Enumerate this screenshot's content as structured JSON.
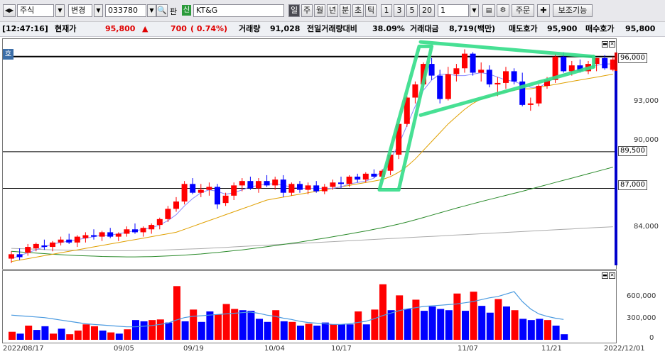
{
  "toolbar": {
    "market": "주식",
    "change_label": "변경",
    "code": "033780",
    "pan_label": "판",
    "sin_badge": "신",
    "stock_name": "KT&G",
    "periods": [
      "일",
      "주",
      "월",
      "년",
      "분",
      "초",
      "틱"
    ],
    "selected_period": "일",
    "intervals": [
      "1",
      "3",
      "5",
      "20"
    ],
    "interval_value": "1",
    "order_button": "주문",
    "aux_button": "보조기능"
  },
  "info": {
    "time": "[12:47:16]",
    "price_label": "현재가",
    "price": "95,800",
    "arrow": "▲",
    "change": "700",
    "change_pct": "( 0.74%)",
    "volume_label": "거래량",
    "volume": "91,028",
    "prev_ratio_label": "전일거래량대비",
    "prev_ratio": "38.09%",
    "amount_label": "거래대금",
    "amount": "8,719(백만)",
    "ask_label": "매도호가",
    "ask": "95,900",
    "bid_label": "매수호가",
    "bid": "95,800"
  },
  "price_panel": {
    "corner_label": "호",
    "y_ticks": [
      "96,000",
      "93,000",
      "90,000",
      "84,000"
    ],
    "levels": [
      "96,000",
      "89,500",
      "87,000"
    ]
  },
  "volume_panel": {
    "y_ticks": [
      "600,000",
      "300,000",
      "0"
    ]
  },
  "dates": [
    "2022/08/17",
    "09/05",
    "09/19",
    "10/04",
    "10/17",
    "11/07",
    "11/21",
    "2022/12/01"
  ],
  "colors": {
    "up": "#ff0000",
    "down": "#0000ff",
    "ma5": "#e0a000",
    "ma20": "#8888ff",
    "ma60": "#2a8a2a",
    "ma120": "#aaaaaa",
    "trend": "#33dd88"
  },
  "chart_data": {
    "type": "candlestick",
    "ylim": [
      81500,
      97200
    ],
    "hlines": [
      96000,
      89500,
      87000
    ],
    "candles": [
      [
        82200,
        82700,
        81900,
        82500
      ],
      [
        82500,
        82900,
        82100,
        82300
      ],
      [
        82600,
        83200,
        82400,
        83000
      ],
      [
        82900,
        83300,
        82700,
        83200
      ],
      [
        83100,
        83500,
        82800,
        83000
      ],
      [
        83000,
        83400,
        82700,
        83300
      ],
      [
        83300,
        83700,
        83100,
        83500
      ],
      [
        83500,
        83900,
        83200,
        83300
      ],
      [
        83300,
        83800,
        83000,
        83700
      ],
      [
        83600,
        84000,
        83300,
        83800
      ],
      [
        83800,
        84200,
        83500,
        83700
      ],
      [
        83700,
        84100,
        83400,
        84000
      ],
      [
        84000,
        84300,
        83600,
        83700
      ],
      [
        83700,
        84000,
        83400,
        83900
      ],
      [
        83900,
        84400,
        83700,
        84200
      ],
      [
        84200,
        84600,
        83900,
        84000
      ],
      [
        84000,
        84400,
        83700,
        84300
      ],
      [
        84200,
        84600,
        83900,
        84500
      ],
      [
        84500,
        85000,
        84200,
        84900
      ],
      [
        84900,
        85800,
        84700,
        85600
      ],
      [
        85600,
        86400,
        85400,
        86100
      ],
      [
        86100,
        87500,
        85900,
        87300
      ],
      [
        87300,
        87700,
        86600,
        86700
      ],
      [
        86700,
        87300,
        86400,
        86900
      ],
      [
        86900,
        87400,
        86500,
        87100
      ],
      [
        87100,
        87300,
        85600,
        85900
      ],
      [
        86000,
        86700,
        85800,
        86500
      ],
      [
        86500,
        87400,
        86200,
        87200
      ],
      [
        87200,
        87700,
        86800,
        87500
      ],
      [
        87500,
        87800,
        86900,
        87000
      ],
      [
        87000,
        87700,
        86700,
        87500
      ],
      [
        87500,
        87900,
        87100,
        87200
      ],
      [
        87200,
        87800,
        86900,
        87600
      ],
      [
        87600,
        87900,
        86400,
        86700
      ],
      [
        86700,
        87400,
        86500,
        87300
      ],
      [
        87300,
        87500,
        86700,
        86900
      ],
      [
        86900,
        87400,
        86600,
        87200
      ],
      [
        87200,
        87500,
        86700,
        86800
      ],
      [
        86800,
        87300,
        86600,
        87100
      ],
      [
        87100,
        87600,
        86900,
        87400
      ],
      [
        87400,
        87800,
        87000,
        87300
      ],
      [
        87300,
        87900,
        87100,
        87800
      ],
      [
        87800,
        88000,
        87400,
        87600
      ],
      [
        87600,
        88100,
        87400,
        88000
      ],
      [
        88000,
        88300,
        87700,
        87800
      ],
      [
        87800,
        88300,
        87600,
        88200
      ],
      [
        88200,
        89400,
        87900,
        89300
      ],
      [
        89300,
        91500,
        89000,
        91400
      ],
      [
        91400,
        93300,
        91200,
        93200
      ],
      [
        93200,
        94300,
        92800,
        94100
      ],
      [
        94100,
        95600,
        93800,
        95500
      ],
      [
        95500,
        95900,
        94400,
        94700
      ],
      [
        94700,
        95100,
        92800,
        93100
      ],
      [
        93100,
        95300,
        93000,
        94800
      ],
      [
        94800,
        95500,
        94300,
        95200
      ],
      [
        95200,
        96500,
        94900,
        96200
      ],
      [
        96200,
        96300,
        94700,
        94900
      ],
      [
        94900,
        95600,
        94300,
        95100
      ],
      [
        95100,
        95400,
        93900,
        94100
      ],
      [
        94100,
        94600,
        93300,
        94200
      ],
      [
        94200,
        95300,
        93800,
        95000
      ],
      [
        95000,
        95200,
        94100,
        94300
      ],
      [
        94300,
        94900,
        92600,
        92700
      ],
      [
        92700,
        93200,
        92300,
        92800
      ],
      [
        92800,
        94100,
        92600,
        94000
      ],
      [
        94000,
        94600,
        93800,
        94400
      ],
      [
        94400,
        96200,
        94200,
        96000
      ],
      [
        96000,
        96300,
        94900,
        95000
      ],
      [
        95000,
        95700,
        94700,
        95400
      ],
      [
        95400,
        95800,
        94900,
        95000
      ],
      [
        95000,
        95700,
        94800,
        95500
      ],
      [
        95500,
        95900,
        95000,
        95900
      ],
      [
        95900,
        96100,
        95100,
        95200
      ],
      [
        95100,
        96000,
        95000,
        95800
      ]
    ],
    "volumes": [
      [
        130000,
        1
      ],
      [
        100000,
        0
      ],
      [
        230000,
        1
      ],
      [
        160000,
        0
      ],
      [
        220000,
        0
      ],
      [
        100000,
        1
      ],
      [
        180000,
        0
      ],
      [
        90000,
        1
      ],
      [
        150000,
        1
      ],
      [
        250000,
        1
      ],
      [
        220000,
        1
      ],
      [
        150000,
        0
      ],
      [
        120000,
        1
      ],
      [
        100000,
        0
      ],
      [
        170000,
        1
      ],
      [
        320000,
        0
      ],
      [
        300000,
        0
      ],
      [
        320000,
        1
      ],
      [
        330000,
        1
      ],
      [
        280000,
        0
      ],
      [
        870000,
        1
      ],
      [
        300000,
        0
      ],
      [
        490000,
        1
      ],
      [
        290000,
        0
      ],
      [
        460000,
        0
      ],
      [
        410000,
        1
      ],
      [
        580000,
        1
      ],
      [
        500000,
        1
      ],
      [
        480000,
        0
      ],
      [
        470000,
        0
      ],
      [
        340000,
        0
      ],
      [
        290000,
        0
      ],
      [
        480000,
        1
      ],
      [
        300000,
        0
      ],
      [
        290000,
        1
      ],
      [
        230000,
        0
      ],
      [
        260000,
        1
      ],
      [
        230000,
        0
      ],
      [
        280000,
        0
      ],
      [
        250000,
        1
      ],
      [
        250000,
        0
      ],
      [
        250000,
        0
      ],
      [
        460000,
        1
      ],
      [
        250000,
        0
      ],
      [
        490000,
        1
      ],
      [
        900000,
        1
      ],
      [
        480000,
        0
      ],
      [
        720000,
        1
      ],
      [
        500000,
        0
      ],
      [
        650000,
        1
      ],
      [
        470000,
        0
      ],
      [
        540000,
        0
      ],
      [
        500000,
        0
      ],
      [
        480000,
        0
      ],
      [
        750000,
        1
      ],
      [
        470000,
        0
      ],
      [
        780000,
        1
      ],
      [
        550000,
        0
      ],
      [
        440000,
        0
      ],
      [
        660000,
        1
      ],
      [
        540000,
        0
      ],
      [
        480000,
        1
      ],
      [
        340000,
        0
      ],
      [
        320000,
        0
      ],
      [
        340000,
        0
      ],
      [
        320000,
        1
      ],
      [
        230000,
        0
      ],
      [
        90000,
        0
      ]
    ],
    "ma5": [
      82200,
      82400,
      82600,
      82800,
      83000,
      83200,
      83300,
      83400,
      83500,
      83600,
      83700,
      83800,
      83800,
      83900,
      84000,
      84100,
      84200,
      84300,
      84500,
      84800,
      85200,
      85800,
      86300,
      86700,
      86900,
      86800,
      86600,
      86700,
      86900,
      87100,
      87200,
      87300,
      87300,
      87200,
      87100,
      87000,
      87000,
      87000,
      87000,
      87000,
      87100,
      87300,
      87400,
      87500,
      87700,
      88200,
      89000,
      90000,
      91300,
      92600,
      93700,
      94400,
      94800,
      94800,
      94700,
      94700,
      94800,
      94900,
      94800,
      94600,
      94400,
      94300,
      94100,
      93900,
      93900,
      94200,
      94600,
      94800,
      95000,
      95100,
      95300,
      95400,
      95500,
      95500
    ],
    "ma20": [
      82000,
      82100,
      82200,
      82300,
      82400,
      82500,
      82600,
      82700,
      82800,
      82900,
      83000,
      83100,
      83200,
      83300,
      83400,
      83500,
      83600,
      83700,
      83800,
      83900,
      84000,
      84200,
      84400,
      84600,
      84800,
      85000,
      85200,
      85400,
      85600,
      85800,
      86000,
      86200,
      86300,
      86400,
      86500,
      86600,
      86700,
      86800,
      86900,
      87000,
      87100,
      87200,
      87300,
      87400,
      87500,
      87600,
      87800,
      88100,
      88500,
      89000,
      89600,
      90200,
      90800,
      91400,
      91900,
      92400,
      92800,
      93100,
      93300,
      93500,
      93600,
      93700,
      93800,
      93800,
      93900,
      94000,
      94100,
      94200,
      94300,
      94400,
      94500,
      94600,
      94700,
      94800
    ],
    "ma60": [
      82700,
      82660,
      82620,
      82580,
      82540,
      82500,
      82470,
      82440,
      82410,
      82390,
      82370,
      82350,
      82340,
      82330,
      82320,
      82320,
      82330,
      82340,
      82360,
      82380,
      82410,
      82440,
      82480,
      82520,
      82570,
      82620,
      82680,
      82740,
      82800,
      82870,
      82940,
      83010,
      83090,
      83170,
      83250,
      83330,
      83420,
      83510,
      83600,
      83690,
      83790,
      83890,
      83990,
      84090,
      84200,
      84310,
      84430,
      84560,
      84700,
      84850,
      85010,
      85170,
      85330,
      85490,
      85650,
      85800,
      85950,
      86100,
      86240,
      86380,
      86520,
      86660,
      86800,
      86950,
      87100,
      87250,
      87400,
      87550,
      87700,
      87850,
      88000,
      88150,
      88300,
      88450
    ],
    "ma120": [
      82900,
      82880,
      82860,
      82840,
      82820,
      82800,
      82790,
      82780,
      82770,
      82760,
      82750,
      82740,
      82740,
      82740,
      82740,
      82750,
      82760,
      82770,
      82780,
      82800,
      82820,
      82840,
      82860,
      82880,
      82910,
      82940,
      82970,
      83000,
      83030,
      83060,
      83090,
      83120,
      83150,
      83180,
      83210,
      83240,
      83270,
      83300,
      83330,
      83360,
      83390,
      83420,
      83450,
      83480,
      83510,
      83540,
      83570,
      83600,
      83630,
      83660,
      83690,
      83720,
      83750,
      83780,
      83810,
      83840,
      83870,
      83900,
      83930,
      83960,
      83990,
      84020,
      84050,
      84080,
      84110,
      84140,
      84170,
      84200,
      84230,
      84260,
      84290,
      84320,
      84350,
      84380
    ],
    "vol_ma": [
      400000,
      390000,
      380000,
      370000,
      360000,
      340000,
      320000,
      300000,
      280000,
      260000,
      250000,
      240000,
      230000,
      220000,
      210000,
      210000,
      220000,
      230000,
      250000,
      270000,
      320000,
      360000,
      380000,
      390000,
      400000,
      410000,
      420000,
      430000,
      440000,
      450000,
      430000,
      400000,
      380000,
      350000,
      330000,
      300000,
      280000,
      270000,
      260000,
      250000,
      250000,
      260000,
      280000,
      300000,
      340000,
      390000,
      430000,
      470000,
      500000,
      520000,
      540000,
      550000,
      560000,
      570000,
      580000,
      600000,
      620000,
      650000,
      680000,
      700000,
      740000,
      780000,
      620000,
      500000,
      420000,
      380000,
      350000,
      330000
    ]
  }
}
